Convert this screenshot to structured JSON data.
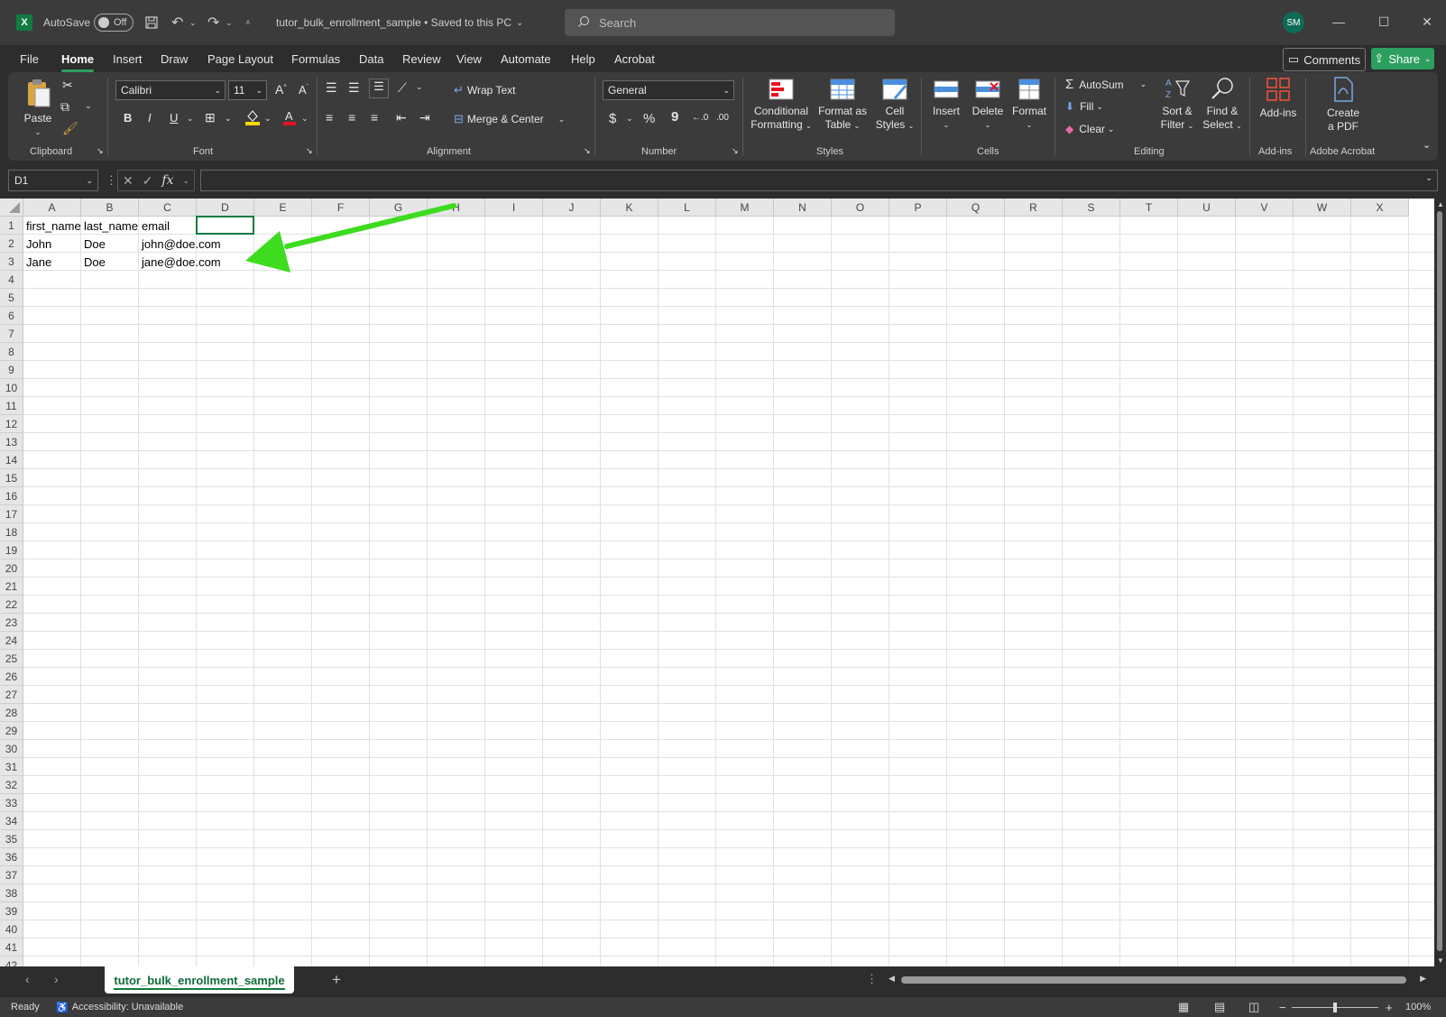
{
  "titlebar": {
    "autosave_label": "AutoSave",
    "autosave_state": "Off",
    "doc_title": "tutor_bulk_enrollment_sample • Saved to this PC",
    "search_placeholder": "Search",
    "user_initials": "SM"
  },
  "menu": {
    "items": [
      "File",
      "Home",
      "Insert",
      "Draw",
      "Page Layout",
      "Formulas",
      "Data",
      "Review",
      "View",
      "Automate",
      "Help",
      "Acrobat"
    ],
    "active": "Home",
    "comments": "Comments",
    "share": "Share"
  },
  "ribbon": {
    "clipboard": {
      "label": "Clipboard",
      "paste": "Paste"
    },
    "font": {
      "label": "Font",
      "name": "Calibri",
      "size": "11",
      "bold": "B",
      "italic": "I",
      "underline": "U"
    },
    "alignment": {
      "label": "Alignment",
      "wrap_text": "Wrap Text",
      "merge_center": "Merge & Center"
    },
    "number": {
      "label": "Number",
      "format": "General",
      "currency": "$",
      "percent": "%",
      "comma": "9"
    },
    "styles": {
      "label": "Styles",
      "conditional_1": "Conditional",
      "conditional_2": "Formatting",
      "format_table_1": "Format as",
      "format_table_2": "Table",
      "cell_styles_1": "Cell",
      "cell_styles_2": "Styles"
    },
    "cells": {
      "label": "Cells",
      "insert": "Insert",
      "delete": "Delete",
      "format": "Format"
    },
    "editing": {
      "label": "Editing",
      "autosum": "AutoSum",
      "fill": "Fill",
      "clear": "Clear",
      "sort_1": "Sort &",
      "sort_2": "Filter",
      "find_1": "Find &",
      "find_2": "Select"
    },
    "addins": {
      "label": "Add-ins",
      "button": "Add-ins"
    },
    "acrobat": {
      "label": "Adobe Acrobat",
      "create_1": "Create",
      "create_2": "a PDF"
    }
  },
  "formula_bar": {
    "name_box": "D1",
    "fx": "fx",
    "formula": ""
  },
  "sheet": {
    "columns": [
      "A",
      "B",
      "C",
      "D",
      "E",
      "F",
      "G",
      "H",
      "I",
      "J",
      "K",
      "L",
      "M",
      "N",
      "O",
      "P",
      "Q",
      "R",
      "S",
      "T",
      "U",
      "V",
      "W",
      "X"
    ],
    "rows_visible": 42,
    "cells": [
      [
        "first_name",
        "last_name",
        "email"
      ],
      [
        "John",
        "Doe",
        "john@doe.com"
      ],
      [
        "Jane",
        "Doe",
        "jane@doe.com"
      ]
    ],
    "annotation_color": "#3ddc1e"
  },
  "sheet_tabs": {
    "active": "tutor_bulk_enrollment_sample",
    "add": "+"
  },
  "status": {
    "ready": "Ready",
    "accessibility": "Accessibility: Unavailable",
    "zoom": "100%",
    "zoom_minus": "−",
    "zoom_plus": "+"
  }
}
